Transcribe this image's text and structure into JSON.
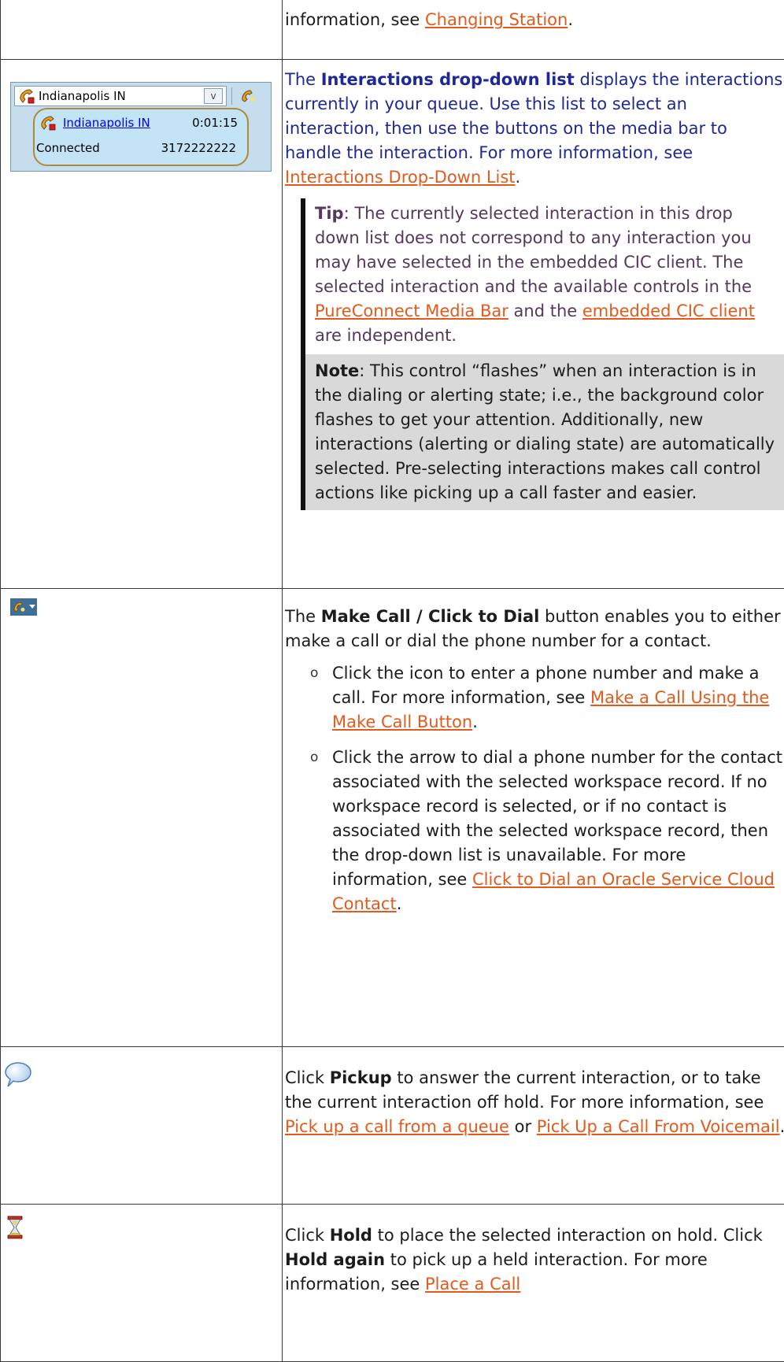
{
  "row_station": {
    "text_pre": "information, see ",
    "link": "Changing Station",
    "text_post": "."
  },
  "row_interactions": {
    "widget": {
      "dropdown_value": "Indianapolis IN",
      "card_name": "Indianapolis IN",
      "card_time": "0:01:15",
      "card_state": "Connected",
      "card_number": "3172222222"
    },
    "p1_pre": "The ",
    "p1_bold": "Interactions drop-down list",
    "p1_mid": " displays the interactions currently in your queue. Use this list to select an interaction, then use the buttons on the media bar to handle the interaction. For more information, see ",
    "p1_link": "Interactions Drop-Down List",
    "p1_end": ".",
    "tip_label": "Tip",
    "tip_text": ": The currently selected interaction in this drop down list does not correspond to any interaction you may have selected in the embedded CIC client. The selected interaction and the available controls in the ",
    "tip_link1": "PureConnect Media Bar",
    "tip_mid": " and the ",
    "tip_link2": "embedded CIC client",
    "tip_end": " are independent.",
    "note_label": "Note",
    "note_text": ": This control “flashes” when an interaction is in the dialing or alerting state; i.e., the background color flashes to get your attention. Additionally, new interactions (alerting or dialing state) are automatically selected. Pre-selecting interactions makes call control actions like picking up a call faster and easier."
  },
  "row_makecall": {
    "p_pre": "The ",
    "p_bold": "Make Call / Click to Dial",
    "p_post": " button enables you to either make a call or dial the phone number for a contact.",
    "b1_text": "Click the icon to enter a phone number and make a call. For more information, see ",
    "b1_link": "Make a Call Using the Make Call Button",
    "b1_end": ".",
    "b2_text": "Click the arrow to dial a phone number for the contact associated with the selected workspace record. If no workspace record is selected, or if no contact is associated with the selected workspace record, then the drop-down list is unavailable. For more information, see ",
    "b2_link": "Click to Dial an Oracle Service Cloud Contact",
    "b2_end": "."
  },
  "row_pickup": {
    "pre": "Click ",
    "bold": "Pickup",
    "mid": " to answer the current interaction, or to take the current interaction off hold. For more information, see ",
    "link1": "Pick up a call from a queue",
    "or": " or ",
    "link2": "Pick Up a Call From Voicemail",
    "end": "."
  },
  "row_hold": {
    "pre": "Click ",
    "bold1": "Hold",
    "mid": " to place the selected interaction on hold. Click ",
    "bold2": "Hold again",
    "post": " to pick up a held interaction. For more information, see ",
    "link": "Place a Call"
  },
  "icons": {
    "phone": "phone-icon",
    "make_call": "make-call-icon",
    "pickup": "speech-bubble-icon",
    "hold": "hourglass-icon"
  }
}
